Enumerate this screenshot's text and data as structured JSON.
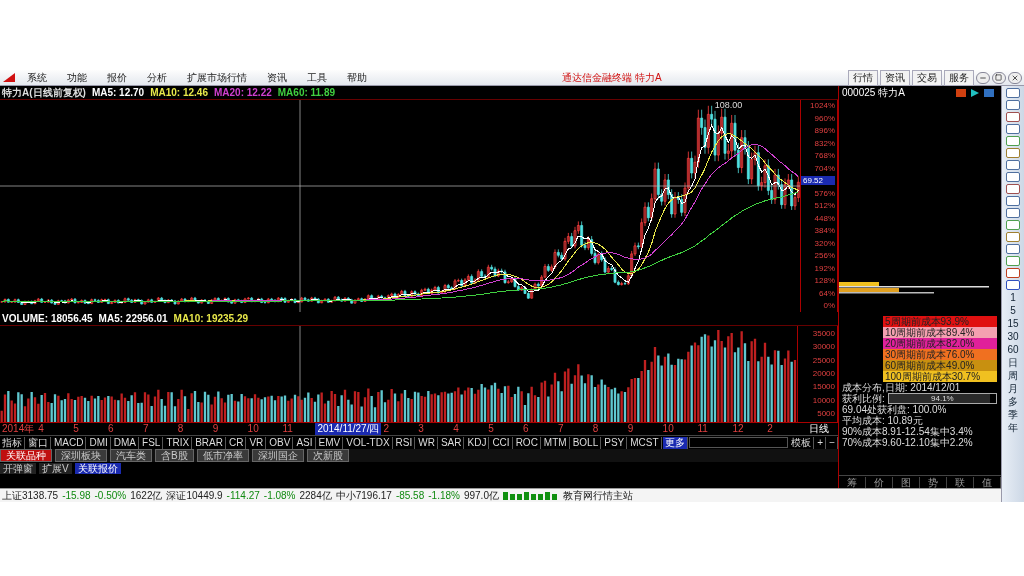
{
  "menu_bar": {
    "items": [
      "系统",
      "功能",
      "报价",
      "分析",
      "扩展市场行情",
      "资讯",
      "工具",
      "帮助"
    ],
    "title": "通达信金融终端 特力A",
    "buttons": [
      "行情",
      "资讯",
      "交易",
      "服务"
    ]
  },
  "chart": {
    "header": {
      "name": "特力A(日线前复权)",
      "ma": [
        {
          "label": "MA5: 12.70",
          "color": "#ffffff"
        },
        {
          "label": "MA10: 12.46",
          "color": "#e8e84a"
        },
        {
          "label": "MA20: 12.22",
          "color": "#d040d0"
        },
        {
          "label": "MA60: 11.89",
          "color": "#40d040"
        }
      ]
    },
    "peak_label": "108.00",
    "price_axis": [
      {
        "label": "1024%",
        "kind": "tick"
      },
      {
        "label": "960%",
        "kind": "tick"
      },
      {
        "label": "896%",
        "kind": "tick"
      },
      {
        "label": "832%",
        "kind": "tick"
      },
      {
        "label": "768%",
        "kind": "tick"
      },
      {
        "label": "704%",
        "kind": "tick"
      },
      {
        "label": "69.52",
        "kind": "tag"
      },
      {
        "label": "576%",
        "kind": "tick"
      },
      {
        "label": "512%",
        "kind": "tick"
      },
      {
        "label": "448%",
        "kind": "tick"
      },
      {
        "label": "384%",
        "kind": "tick"
      },
      {
        "label": "320%",
        "kind": "tick"
      },
      {
        "label": "256%",
        "kind": "tick"
      },
      {
        "label": "192%",
        "kind": "tick"
      },
      {
        "label": "128%",
        "kind": "tick"
      },
      {
        "label": "64%",
        "kind": "tick"
      },
      {
        "label": "0%",
        "kind": "tick"
      }
    ],
    "volume_header": [
      {
        "label": "VOLUME: 18056.45",
        "color": "#ffffff"
      },
      {
        "label": "MA5: 22956.01",
        "color": "#ffffff"
      },
      {
        "label": "MA10: 19235.29",
        "color": "#e8e84a"
      }
    ],
    "volume_axis": [
      "35000",
      "30000",
      "25000",
      "20000",
      "15000",
      "10000",
      "5000"
    ],
    "date_axis": [
      {
        "label": "2014年",
        "selected": false
      },
      {
        "label": "4",
        "selected": false
      },
      {
        "label": "5",
        "selected": false
      },
      {
        "label": "6",
        "selected": false
      },
      {
        "label": "7",
        "selected": false
      },
      {
        "label": "8",
        "selected": false
      },
      {
        "label": "9",
        "selected": false
      },
      {
        "label": "10",
        "selected": false
      },
      {
        "label": "11",
        "selected": false
      },
      {
        "label": "2014/11/27/四",
        "selected": true
      },
      {
        "label": "2",
        "selected": false
      },
      {
        "label": "3",
        "selected": false
      },
      {
        "label": "4",
        "selected": false
      },
      {
        "label": "5",
        "selected": false
      },
      {
        "label": "6",
        "selected": false
      },
      {
        "label": "7",
        "selected": false
      },
      {
        "label": "8",
        "selected": false
      },
      {
        "label": "9",
        "selected": false
      },
      {
        "label": "10",
        "selected": false
      },
      {
        "label": "11",
        "selected": false
      },
      {
        "label": "12",
        "selected": false
      },
      {
        "label": "2",
        "selected": false
      }
    ],
    "period": "日线"
  },
  "indicator_tabs": [
    {
      "label": "指标",
      "selected": false
    },
    {
      "label": "窗口",
      "selected": false
    },
    {
      "label": "MACD",
      "selected": false
    },
    {
      "label": "DMI",
      "selected": false
    },
    {
      "label": "DMA",
      "selected": false
    },
    {
      "label": "FSL",
      "selected": false
    },
    {
      "label": "TRIX",
      "selected": false
    },
    {
      "label": "BRAR",
      "selected": false
    },
    {
      "label": "CR",
      "selected": false
    },
    {
      "label": "VR",
      "selected": false
    },
    {
      "label": "OBV",
      "selected": false
    },
    {
      "label": "ASI",
      "selected": false
    },
    {
      "label": "EMV",
      "selected": false
    },
    {
      "label": "VOL-TDX",
      "selected": false
    },
    {
      "label": "RSI",
      "selected": false
    },
    {
      "label": "WR",
      "selected": false
    },
    {
      "label": "SAR",
      "selected": false
    },
    {
      "label": "KDJ",
      "selected": false
    },
    {
      "label": "CCI",
      "selected": false
    },
    {
      "label": "ROC",
      "selected": false
    },
    {
      "label": "MTM",
      "selected": false
    },
    {
      "label": "BOLL",
      "selected": false
    },
    {
      "label": "PSY",
      "selected": false
    },
    {
      "label": "MCST",
      "selected": false
    },
    {
      "label": "更多",
      "selected": true
    }
  ],
  "template_buttons": [
    "模板",
    "+",
    "−"
  ],
  "sector_tabs": [
    {
      "label": "关联品种",
      "selected": true
    },
    {
      "label": "深圳板块",
      "selected": false
    },
    {
      "label": "汽车类",
      "selected": false
    },
    {
      "label": "含B股",
      "selected": false
    },
    {
      "label": "低市净率",
      "selected": false
    },
    {
      "label": "深圳国企",
      "selected": false
    },
    {
      "label": "次新股",
      "selected": false
    }
  ],
  "sub_tabs": [
    {
      "label": "开弹窗",
      "selected": false
    },
    {
      "label": "扩展V",
      "selected": false
    },
    {
      "label": "关联报价",
      "selected": true
    }
  ],
  "status_bar": {
    "indices": [
      {
        "name": "上证3138.75",
        "change": "-15.98",
        "percent": "-0.50%",
        "amount": "1622亿"
      },
      {
        "name": "深证10449.9",
        "change": "-114.27",
        "percent": "-1.08%",
        "amount": "2284亿"
      },
      {
        "name": "中小7196.17",
        "change": "-85.58",
        "percent": "-1.18%",
        "amount": "997.0亿"
      }
    ],
    "server": "教育网行情主站"
  },
  "side_panel": {
    "stock": "000025 特力A",
    "cost_legend": [
      {
        "label": "5周期前成本93.9%",
        "color": "#e01010"
      },
      {
        "label": "10周期前成本89.4%",
        "color": "#f4a0b0"
      },
      {
        "label": "20周期前成本82.0%",
        "color": "#e0209a"
      },
      {
        "label": "30周期前成本76.0%",
        "color": "#f07020"
      },
      {
        "label": "60周期前成本49.0%",
        "color": "#c89010"
      },
      {
        "label": "100周期前成本30.7%",
        "color": "#f0c020"
      }
    ],
    "date_line": "成本分布,日期: 2014/12/01",
    "profit_label": "获利比例:",
    "profit_reading": "94.1%",
    "profit": {
      "level": 0.941
    },
    "lines": [
      "69.04处获利盘: 100.0%",
      "平均成本: 10.89元",
      "90%成本8.91-12.54集中3.4%",
      "70%成本9.60-12.10集中2.2%"
    ],
    "tabs": [
      {
        "label": "筹",
        "selected": false
      },
      {
        "label": "价",
        "selected": false
      },
      {
        "label": "图",
        "selected": false
      },
      {
        "label": "势",
        "selected": false
      },
      {
        "label": "联",
        "selected": false
      },
      {
        "label": "值",
        "selected": false
      }
    ]
  },
  "toolbar": {
    "periods": [
      "1",
      "5",
      "15",
      "30",
      "60",
      "日",
      "周",
      "月",
      "多",
      "季",
      "年"
    ]
  }
}
